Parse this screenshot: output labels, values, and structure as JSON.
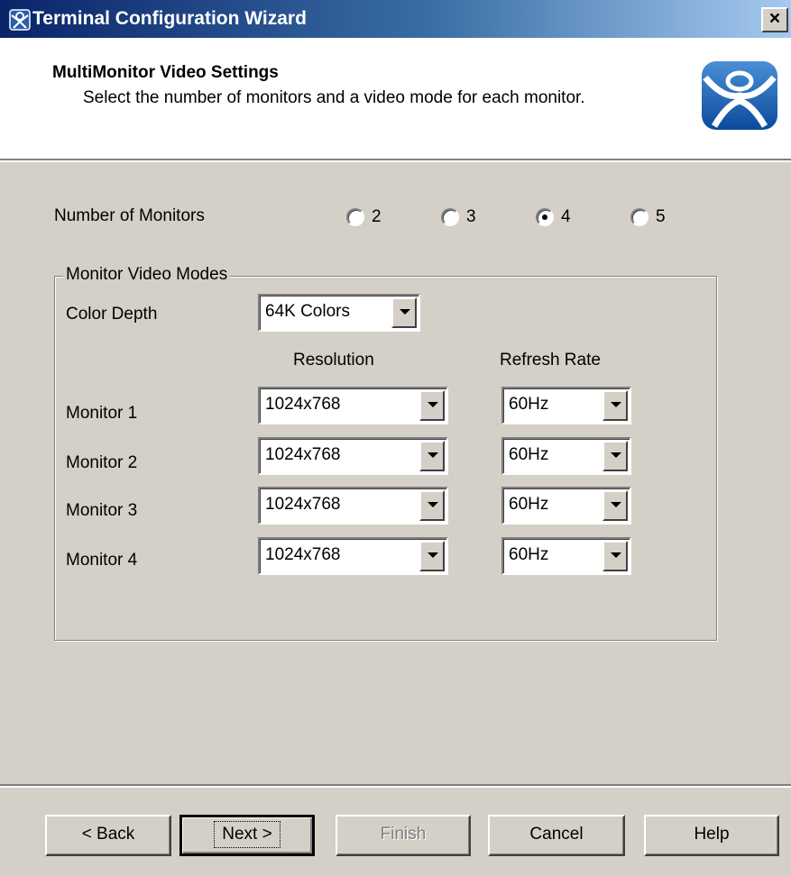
{
  "window": {
    "title": "Terminal Configuration Wizard",
    "close_label": "×"
  },
  "header": {
    "title": "MultiMonitor Video Settings",
    "description": "Select the number of monitors and a video mode for each monitor."
  },
  "monitors_count": {
    "label": "Number of Monitors",
    "options": [
      "2",
      "3",
      "4",
      "5"
    ],
    "selected": "4"
  },
  "video_modes": {
    "group_label": "Monitor Video Modes",
    "color_depth_label": "Color Depth",
    "color_depth_value": "64K Colors",
    "resolution_header": "Resolution",
    "refresh_header": "Refresh Rate",
    "monitors": [
      {
        "label": "Monitor 1",
        "resolution": "1024x768",
        "refresh": "60Hz"
      },
      {
        "label": "Monitor 2",
        "resolution": "1024x768",
        "refresh": "60Hz"
      },
      {
        "label": "Monitor 3",
        "resolution": "1024x768",
        "refresh": "60Hz"
      },
      {
        "label": "Monitor 4",
        "resolution": "1024x768",
        "refresh": "60Hz"
      }
    ]
  },
  "buttons": {
    "back": "< Back",
    "next": "Next >",
    "finish": "Finish",
    "cancel": "Cancel",
    "help": "Help"
  }
}
